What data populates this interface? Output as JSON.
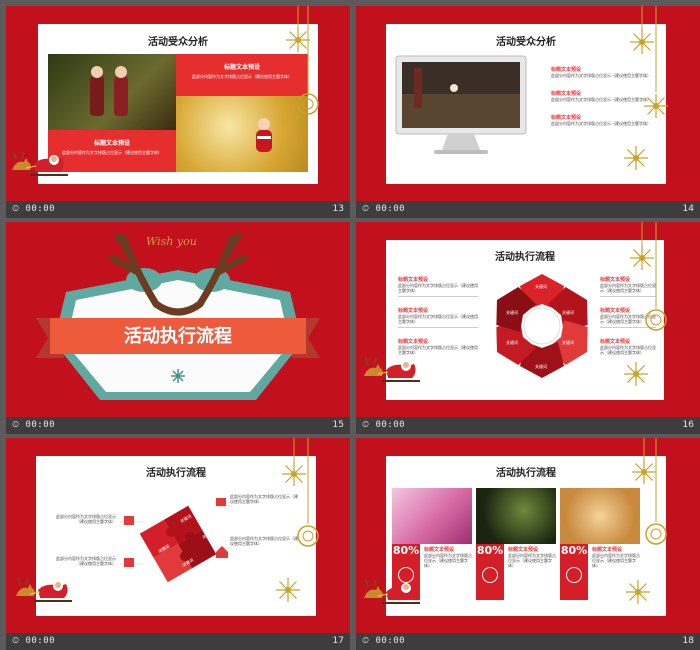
{
  "slides": [
    {
      "number": "13",
      "time": "00:00",
      "title": "活动受众分析",
      "box1": {
        "heading": "标题文本预设",
        "body": "此部分内容作为文字排版占位显示（建议使用主题字体）"
      },
      "box2": {
        "heading": "标题文本预设",
        "body": "此部分内容作为文字排版占位显示（建议使用主题字体）"
      }
    },
    {
      "number": "14",
      "time": "00:00",
      "title": "活动受众分析",
      "items": [
        {
          "heading": "标题文本预设",
          "body": "此部分内容作为文字排版占位显示（建议使用主题字体）"
        },
        {
          "heading": "标题文本预设",
          "body": "此部分内容作为文字排版占位显示（建议使用主题字体）"
        },
        {
          "heading": "标题文本预设",
          "body": "此部分内容作为文字排版占位显示（建议使用主题字体）"
        }
      ]
    },
    {
      "number": "15",
      "time": "00:00",
      "wish": "Wish you",
      "banner": "活动执行流程"
    },
    {
      "number": "16",
      "time": "00:00",
      "title": "活动执行流程",
      "left": [
        {
          "heading": "标题文本预设",
          "body": "此部分内容作为文字排版占位显示（建议使用主题字体）"
        },
        {
          "heading": "标题文本预设",
          "body": "此部分内容作为文字排版占位显示（建议使用主题字体）"
        },
        {
          "heading": "标题文本预设",
          "body": "此部分内容作为文字排版占位显示（建议使用主题字体）"
        }
      ],
      "right": [
        {
          "heading": "标题文本预设",
          "body": "此部分内容作为文字排版占位显示（建议使用主题字体）"
        },
        {
          "heading": "标题文本预设",
          "body": "此部分内容作为文字排版占位显示（建议使用主题字体）"
        },
        {
          "heading": "标题文本预设",
          "body": "此部分内容作为文字排版占位显示（建议使用主题字体）"
        }
      ],
      "petals": [
        "关键词",
        "关键词",
        "关键词",
        "关键词",
        "关键词",
        "关键词"
      ]
    },
    {
      "number": "17",
      "time": "00:00",
      "title": "活动执行流程",
      "notes": [
        "此部分内容作为文字排版占位显示（建议使用主题字体）",
        "此部分内容作为文字排版占位显示（建议使用主题字体）",
        "此部分内容作为文字排版占位显示（建议使用主题字体）",
        "此部分内容作为文字排版占位显示（建议使用主题字体）"
      ],
      "pieces": [
        "关键词",
        "关键词",
        "关键词",
        "关键词"
      ]
    },
    {
      "number": "18",
      "time": "00:00",
      "title": "活动执行流程",
      "cols": [
        {
          "pct": "80%",
          "heading": "标题文本预设",
          "body": "此部分内容作为文字排版占位显示（建议使用主题字体）"
        },
        {
          "pct": "80%",
          "heading": "标题文本预设",
          "body": "此部分内容作为文字排版占位显示（建议使用主题字体）"
        },
        {
          "pct": "80%",
          "heading": "标题文本预设",
          "body": "此部分内容作为文字排版占位显示（建议使用主题字体）"
        }
      ]
    }
  ],
  "colors": {
    "red": "#c2111c",
    "bright_red": "#e62e2e",
    "gold": "#c9a227",
    "footer": "#3d3d3d",
    "bg": "#5b5b5b"
  },
  "icons": {
    "clock": "clock-icon"
  }
}
